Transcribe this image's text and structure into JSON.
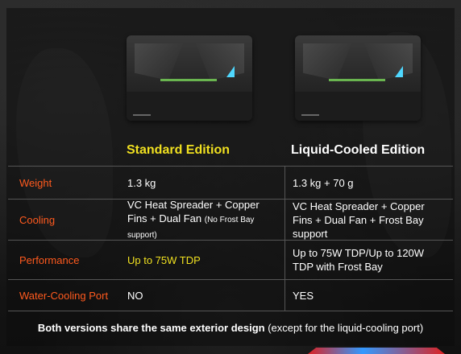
{
  "columns": {
    "standard": "Standard Edition",
    "liquid": "Liquid-Cooled Edition"
  },
  "rows": [
    {
      "label": "Weight",
      "standard": "1.3 kg",
      "liquid": "1.3 kg + 70 g"
    },
    {
      "label": "Cooling",
      "standard": "VC Heat Spreader + Copper Fins + Dual Fan",
      "standard_note": "(No Frost Bay support)",
      "liquid": "VC Heat Spreader + Copper Fins + Dual Fan + Frost Bay support"
    },
    {
      "label": "Performance",
      "standard": "Up to 75W TDP",
      "liquid": "Up to 75W TDP/Up to 120W TDP with Frost Bay"
    },
    {
      "label": "Water-Cooling Port",
      "standard": "NO",
      "liquid": "YES"
    }
  ],
  "footer": {
    "bold": "Both versions share the same exterior design",
    "rest": " (except for the liquid-cooling port)"
  },
  "colors": {
    "label": "#ff5a1e",
    "highlight": "#f0e020",
    "accent_blue": "#4fd8ff",
    "accent_green": "#7bd85a"
  }
}
